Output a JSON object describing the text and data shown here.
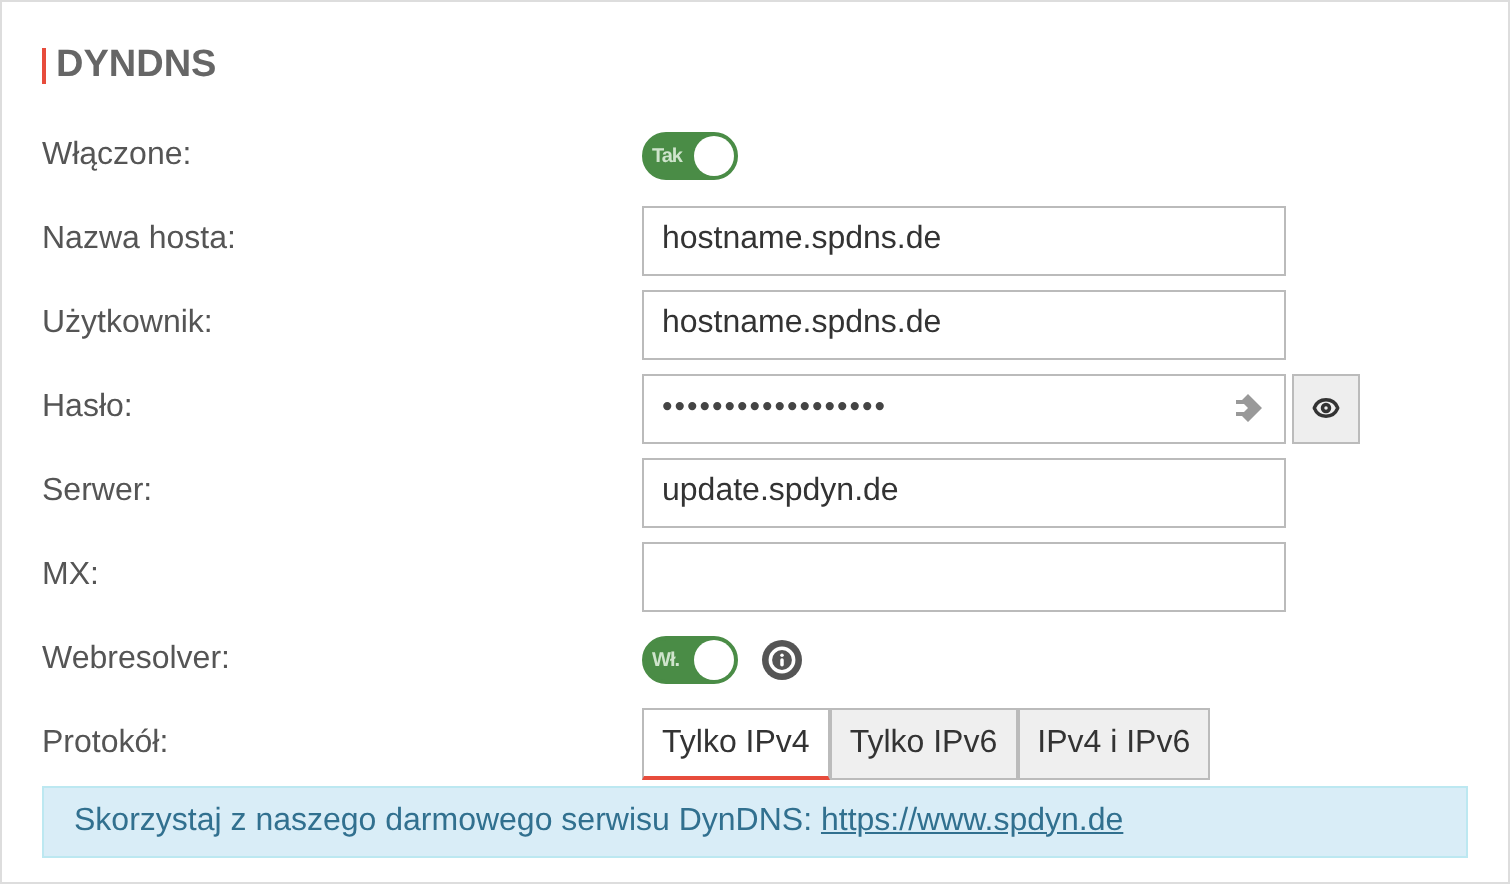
{
  "section": {
    "title": "DYNDNS"
  },
  "rows": [
    {
      "kind": "toggle",
      "label": "Włączone:",
      "on": true,
      "toggle_text": "Tak"
    },
    {
      "kind": "text",
      "label": "Nazwa hosta:",
      "value": "hostname.spdns.de"
    },
    {
      "kind": "text",
      "label": "Użytkownik:",
      "value": "hostname.spdns.de"
    },
    {
      "kind": "password",
      "label": "Hasło:",
      "value": "••••••••••••••••••"
    },
    {
      "kind": "text",
      "label": "Serwer:",
      "value": "update.spdyn.de"
    },
    {
      "kind": "text",
      "label": "MX:",
      "value": ""
    },
    {
      "kind": "toggle",
      "label": "Webresolver:",
      "on": true,
      "toggle_text": "Wł.",
      "info": true
    },
    {
      "kind": "tabs",
      "label": "Protokół:",
      "options": [
        {
          "label": "Tylko IPv4",
          "selected": true
        },
        {
          "label": "Tylko IPv6",
          "selected": false
        },
        {
          "label": "IPv4 i IPv6",
          "selected": false
        }
      ]
    }
  ],
  "notice": {
    "text": "Skorzystaj z naszego darmowego serwisu DynDNS:",
    "link": "https://www.spdyn.de"
  }
}
